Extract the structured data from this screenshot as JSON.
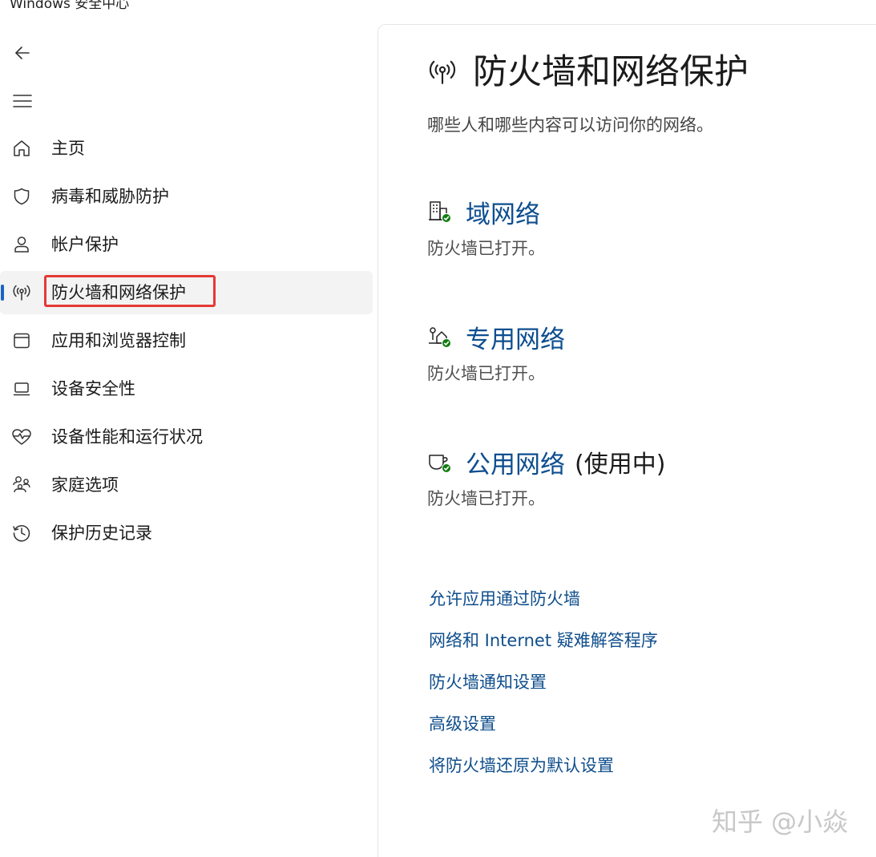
{
  "window": {
    "title": "Windows 安全中心"
  },
  "sidebar": {
    "back_icon": "arrow-left-icon",
    "menu_icon": "hamburger-menu-icon",
    "items": [
      {
        "label": "主页",
        "icon": "home-icon"
      },
      {
        "label": "病毒和威胁防护",
        "icon": "shield-icon"
      },
      {
        "label": "帐户保护",
        "icon": "person-icon"
      },
      {
        "label": "防火墙和网络保护",
        "icon": "wireless-antenna-icon",
        "active": true
      },
      {
        "label": "应用和浏览器控制",
        "icon": "app-window-icon"
      },
      {
        "label": "设备安全性",
        "icon": "laptop-icon"
      },
      {
        "label": "设备性能和运行状况",
        "icon": "heart-pulse-icon"
      },
      {
        "label": "家庭选项",
        "icon": "family-icon"
      },
      {
        "label": "保护历史记录",
        "icon": "history-icon"
      }
    ]
  },
  "main": {
    "title": "防火墙和网络保护",
    "title_icon": "wireless-antenna-icon",
    "subtitle": "哪些人和哪些内容可以访问你的网络。",
    "networks": [
      {
        "name": "域网络",
        "suffix": "",
        "status": "防火墙已打开。",
        "icon": "domain-network-icon"
      },
      {
        "name": "专用网络",
        "suffix": "",
        "status": "防火墙已打开。",
        "icon": "private-network-icon"
      },
      {
        "name": "公用网络",
        "suffix": "(使用中)",
        "status": "防火墙已打开。",
        "icon": "public-network-icon"
      }
    ],
    "links": [
      "允许应用通过防火墙",
      "网络和 Internet 疑难解答程序",
      "防火墙通知设置",
      "高级设置",
      "将防火墙还原为默认设置"
    ]
  },
  "watermark": "知乎 @小焱",
  "colors": {
    "accent": "#1a63c5",
    "link": "#0f4e8c",
    "check_green": "#107c10",
    "highlight_red": "#e53935"
  }
}
